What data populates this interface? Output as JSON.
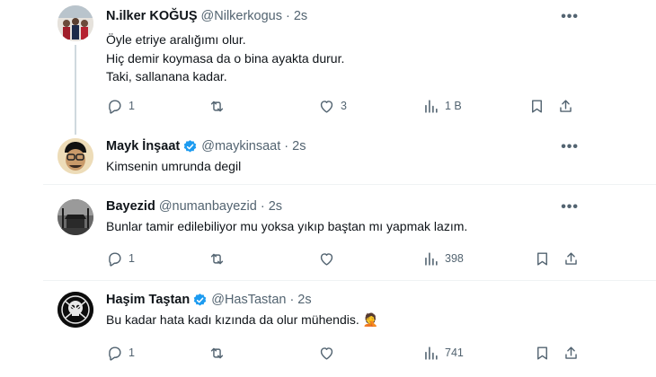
{
  "tweets": [
    {
      "name": "N.ilker KOĞUŞ",
      "handle": "@Nilkerkogus",
      "time": "2s",
      "verified": false,
      "text": "Öyle etriye aralığımı olur.\nHiç demir koymasa da o bina ayakta durur.\nTaki, sallanana kadar.",
      "replies": "1",
      "retweets": "",
      "likes": "3",
      "views": "1 B"
    },
    {
      "name": "Mayk İnşaat",
      "handle": "@maykinsaat",
      "time": "2s",
      "verified": true,
      "text": "Kimsenin umrunda degil"
    },
    {
      "name": "Bayezid",
      "handle": "@numanbayezid",
      "time": "2s",
      "verified": false,
      "text": "Bunlar tamir edilebiliyor mu yoksa yıkıp baştan mı yapmak lazım.",
      "replies": "1",
      "retweets": "",
      "likes": "",
      "views": "398"
    },
    {
      "name": "Haşim Taştan",
      "handle": "@HasTastan",
      "time": "2s",
      "verified": true,
      "text": "Bu kadar hata kadı kızında da olur mühendis. 🤦",
      "replies": "1",
      "retweets": "",
      "likes": "",
      "views": "741"
    }
  ],
  "separator": "·",
  "more_glyph": "•••",
  "colors": {
    "verified": "#1d9bf0",
    "secondary": "#536471",
    "border": "#eff3f4"
  }
}
